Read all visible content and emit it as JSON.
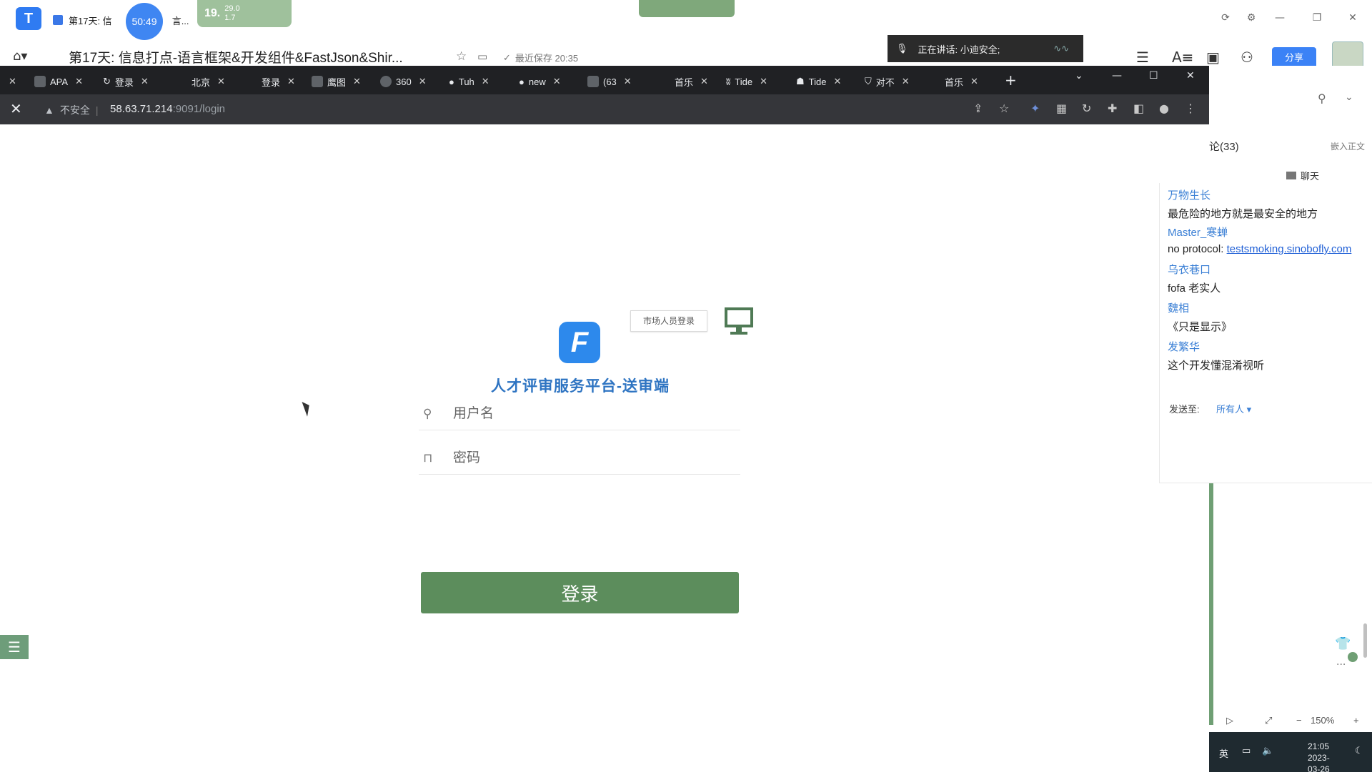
{
  "outer_app": {
    "logo_glyph": "T",
    "doc_tab_label": "第17天: 信",
    "doc_tab_suffix": "言...",
    "timer": "50:49",
    "weather_temp": "19.",
    "weather_info": "29.0",
    "weather_info2": "1.7",
    "doc_title": "第17天: 信息打点-语言框架&开发组件&FastJson&Shir...",
    "save_status": "最近保存 20:35",
    "speaking": "正在讲话: 小迪安全;",
    "share_label": "分享"
  },
  "browser": {
    "tabs": [
      {
        "label": "APA"
      },
      {
        "label": "登录"
      },
      {
        "label": "北京"
      },
      {
        "label": "登录"
      },
      {
        "label": "鹰图"
      },
      {
        "label": "360"
      },
      {
        "label": "Tuh"
      },
      {
        "label": "new"
      },
      {
        "label": "(63"
      },
      {
        "label": "首乐"
      },
      {
        "label": "Tide"
      },
      {
        "label": "Tide"
      },
      {
        "label": "对不"
      },
      {
        "label": "首乐"
      }
    ],
    "insecure_label": "不安全",
    "url_host": "58.63.71.214",
    "url_path": ":9091/login"
  },
  "login": {
    "logo_letter": "F",
    "market_login": "市场人员登录",
    "title": "人才评审服务平台-送审端",
    "username_placeholder": "用户名",
    "password_placeholder": "密码",
    "submit": "登录"
  },
  "chat": {
    "comment_count": "论(33)",
    "embed_label": "嵌入正文",
    "tab_label": "聊天",
    "messages": [
      {
        "user": "万物生长",
        "text": "最危险的地方就是最安全的地方"
      },
      {
        "user": "Master_寒蝉",
        "text_prefix": "no protocol: ",
        "link": "testsmoking.sinobofly.com"
      },
      {
        "user": "乌衣巷口",
        "text": "fofa 老实人"
      },
      {
        "user": "魏相",
        "text": "《只是显示》"
      },
      {
        "user": "发繁华",
        "text": "这个开发懂混淆视听"
      }
    ],
    "send_to_label": "发送至:",
    "recipient": "所有人"
  },
  "zoom": {
    "level": "150%"
  },
  "taskbar": {
    "ime": "英",
    "time": "21:05",
    "date": "2023-03-26"
  },
  "colors": {
    "accent": "#2d89ec",
    "login_button": "#5c8d5c",
    "chat_user": "#3a7fd5"
  }
}
